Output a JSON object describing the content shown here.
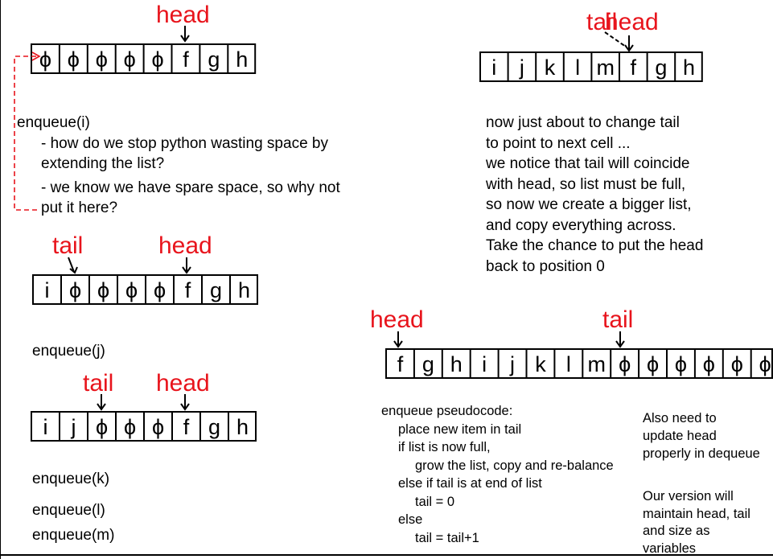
{
  "labels": {
    "head": "head",
    "tail": "tail"
  },
  "arrays": {
    "a1": [
      "ϕ",
      "ϕ",
      "ϕ",
      "ϕ",
      "ϕ",
      "f",
      "g",
      "h"
    ],
    "a2": [
      "i",
      "ϕ",
      "ϕ",
      "ϕ",
      "ϕ",
      "f",
      "g",
      "h"
    ],
    "a3": [
      "i",
      "j",
      "ϕ",
      "ϕ",
      "ϕ",
      "f",
      "g",
      "h"
    ],
    "a4": [
      "i",
      "j",
      "k",
      "l",
      "m",
      "f",
      "g",
      "h"
    ],
    "a5": [
      "f",
      "g",
      "h",
      "i",
      "j",
      "k",
      "l",
      "m",
      "ϕ",
      "ϕ",
      "ϕ",
      "ϕ",
      "ϕ",
      "ϕ"
    ]
  },
  "notes": {
    "enqueue_i": [
      "enqueue(i)",
      "- how do we stop python wasting space by",
      "extending the list?",
      "- we know we have spare space, so why not",
      "put it here?"
    ],
    "enqueue_j": "enqueue(j)",
    "enqueue_k": "enqueue(k)",
    "enqueue_l": "enqueue(l)",
    "enqueue_m": "enqueue(m)",
    "full_note": [
      "now just about to change tail",
      "to point to next cell ...",
      "we notice that tail will coincide",
      "with head, so list must be full,",
      "so now we create a bigger list,",
      "and copy everything across.",
      "Take the chance to put the head",
      "back to position 0"
    ],
    "pseudocode": [
      "enqueue pseudocode:",
      "place new item in tail",
      "if list is now full,",
      "grow the list, copy and re-balance",
      "else if tail is at end of list",
      "tail = 0",
      "else",
      "tail = tail+1"
    ],
    "dequeue_note": [
      "Also need to",
      "update head",
      "properly in dequeue"
    ],
    "version_note": [
      "Our version will",
      "maintain head, tail",
      "and size as",
      "variables"
    ]
  },
  "colors": {
    "label": "#e8141c",
    "line": "#000000"
  }
}
